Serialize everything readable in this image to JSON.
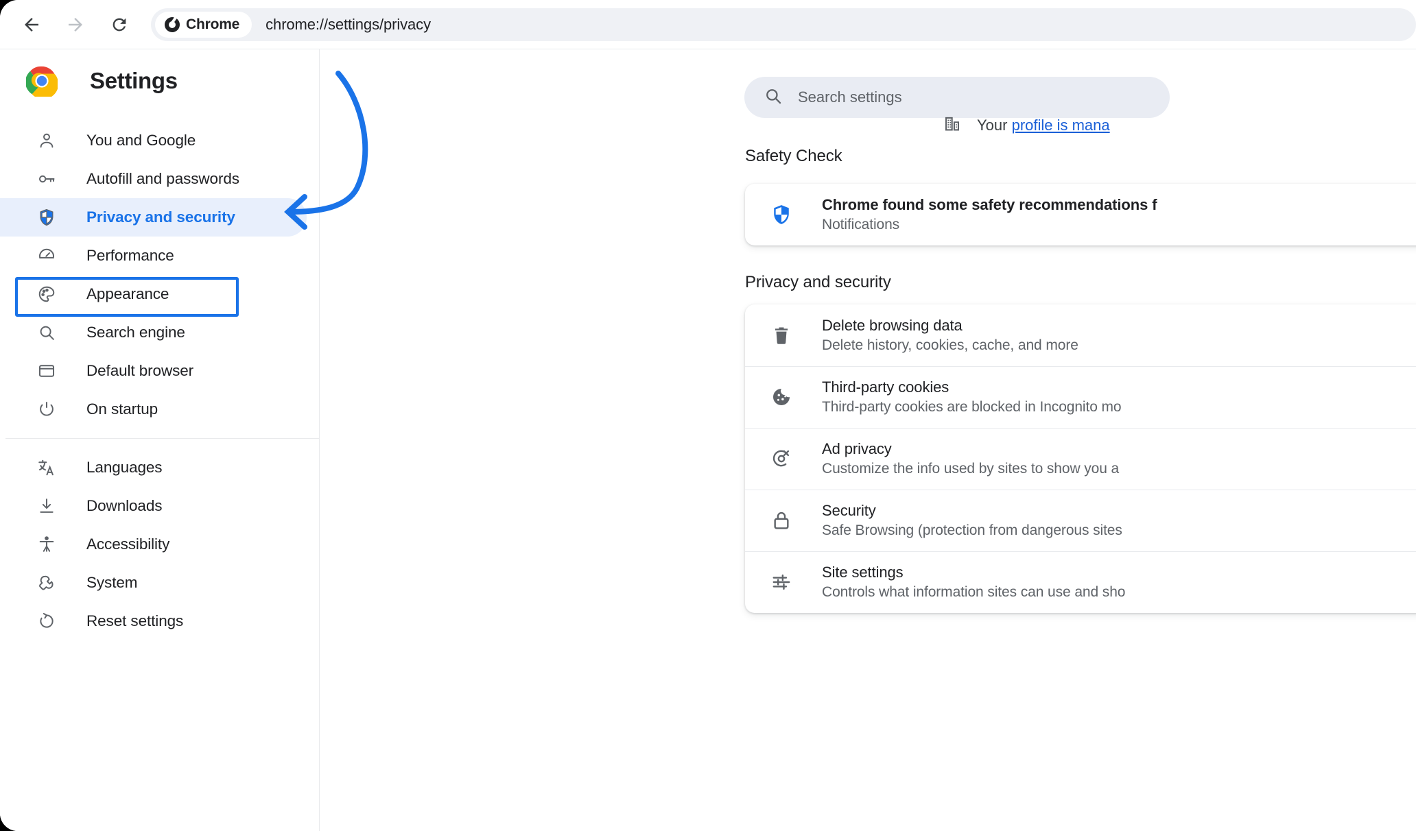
{
  "accent": "#1a73e8",
  "browser": {
    "back_icon": "back-arrow-icon",
    "forward_icon": "forward-arrow-icon",
    "reload_icon": "reload-icon",
    "chip_label": "Chrome",
    "chip_icon": "chrome-logo-icon",
    "url": "chrome://settings/privacy"
  },
  "sidebar": {
    "logo_icon": "chrome-logo-icon",
    "title": "Settings",
    "groups": [
      {
        "items": [
          {
            "label": "You and Google",
            "icon": "person-icon",
            "selected": false
          },
          {
            "label": "Autofill and passwords",
            "icon": "key-icon",
            "selected": false
          },
          {
            "label": "Privacy and security",
            "icon": "shield-icon",
            "selected": true
          },
          {
            "label": "Performance",
            "icon": "speedometer-icon",
            "selected": false
          },
          {
            "label": "Appearance",
            "icon": "palette-icon",
            "selected": false
          },
          {
            "label": "Search engine",
            "icon": "magnifier-icon",
            "selected": false
          },
          {
            "label": "Default browser",
            "icon": "window-icon",
            "selected": false
          },
          {
            "label": "On startup",
            "icon": "power-icon",
            "selected": false
          }
        ]
      },
      {
        "items": [
          {
            "label": "Languages",
            "icon": "translate-icon",
            "selected": false
          },
          {
            "label": "Downloads",
            "icon": "download-icon",
            "selected": false
          },
          {
            "label": "Accessibility",
            "icon": "accessibility-icon",
            "selected": false
          },
          {
            "label": "System",
            "icon": "wrench-icon",
            "selected": false
          },
          {
            "label": "Reset settings",
            "icon": "reset-icon",
            "selected": false
          }
        ]
      }
    ]
  },
  "search": {
    "placeholder": "Search settings",
    "icon": "search-icon",
    "value": ""
  },
  "profile_notice": {
    "icon": "building-icon",
    "prefix": "Your ",
    "link_text": "profile is mana"
  },
  "sections": [
    {
      "heading": "Safety Check",
      "rows": [
        {
          "icon": "shield-icon",
          "title": "Chrome found some safety recommendations f",
          "subtitle": "Notifications",
          "title_strong": true
        }
      ]
    },
    {
      "heading": "Privacy and security",
      "rows": [
        {
          "icon": "trash-icon",
          "title": "Delete browsing data",
          "subtitle": "Delete history, cookies, cache, and more",
          "title_strong": false
        },
        {
          "icon": "cookie-icon",
          "title": "Third-party cookies",
          "subtitle": "Third-party cookies are blocked in Incognito mo",
          "title_strong": false
        },
        {
          "icon": "ad-privacy-icon",
          "title": "Ad privacy",
          "subtitle": "Customize the info used by sites to show you a",
          "title_strong": false
        },
        {
          "icon": "lock-icon",
          "title": "Security",
          "subtitle": "Safe Browsing (protection from dangerous sites",
          "title_strong": false
        },
        {
          "icon": "sliders-icon",
          "title": "Site settings",
          "subtitle": "Controls what information sites can use and sho",
          "title_strong": false
        }
      ]
    }
  ],
  "annotation": {
    "icon": "curved-arrow-icon",
    "color": "#1a73e8",
    "points_to": "Privacy and security"
  }
}
